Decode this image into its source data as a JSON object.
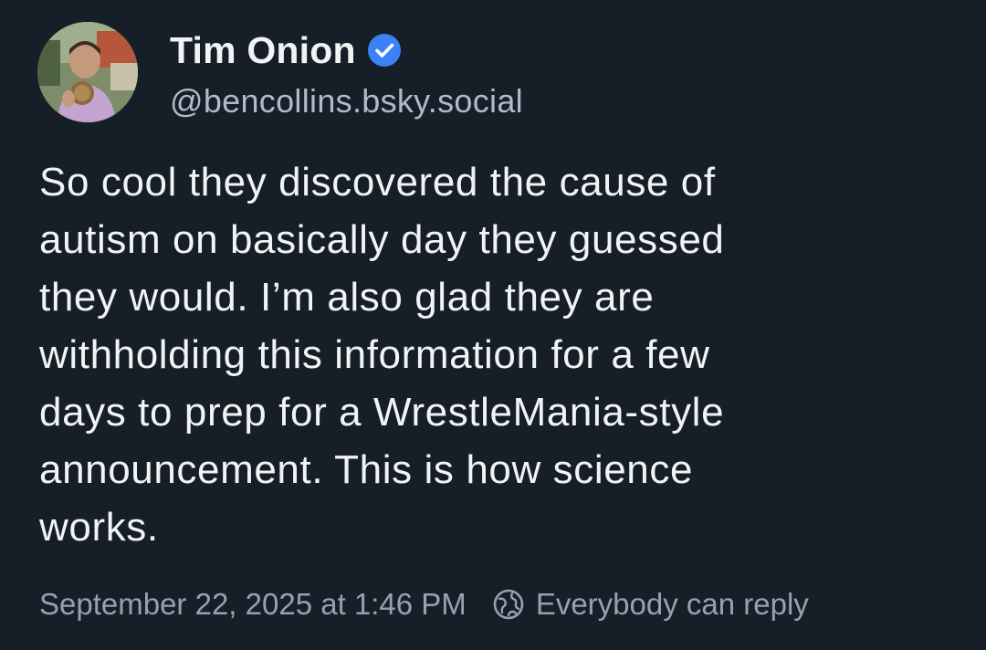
{
  "author": {
    "display_name": "Tim Onion",
    "handle": "@bencollins.bsky.social",
    "verified_icon": "verified-check-icon",
    "avatar_icon": "avatar-photo"
  },
  "post": {
    "text": "So cool they discovered the cause of\nautism on basically day they guessed\nthey would. I’m also glad they are\nwithholding this information for a few\ndays to prep for a WrestleMania-style\nannouncement. This is how science\nworks.",
    "timestamp": "September 22, 2025 at 1:46 PM",
    "reply_setting": "Everybody can reply",
    "reply_icon": "globe-icon"
  },
  "colors": {
    "background": "#161e27",
    "text": "#f1f3f5",
    "secondary": "#aebbc9",
    "verified": "#3b82f6"
  }
}
